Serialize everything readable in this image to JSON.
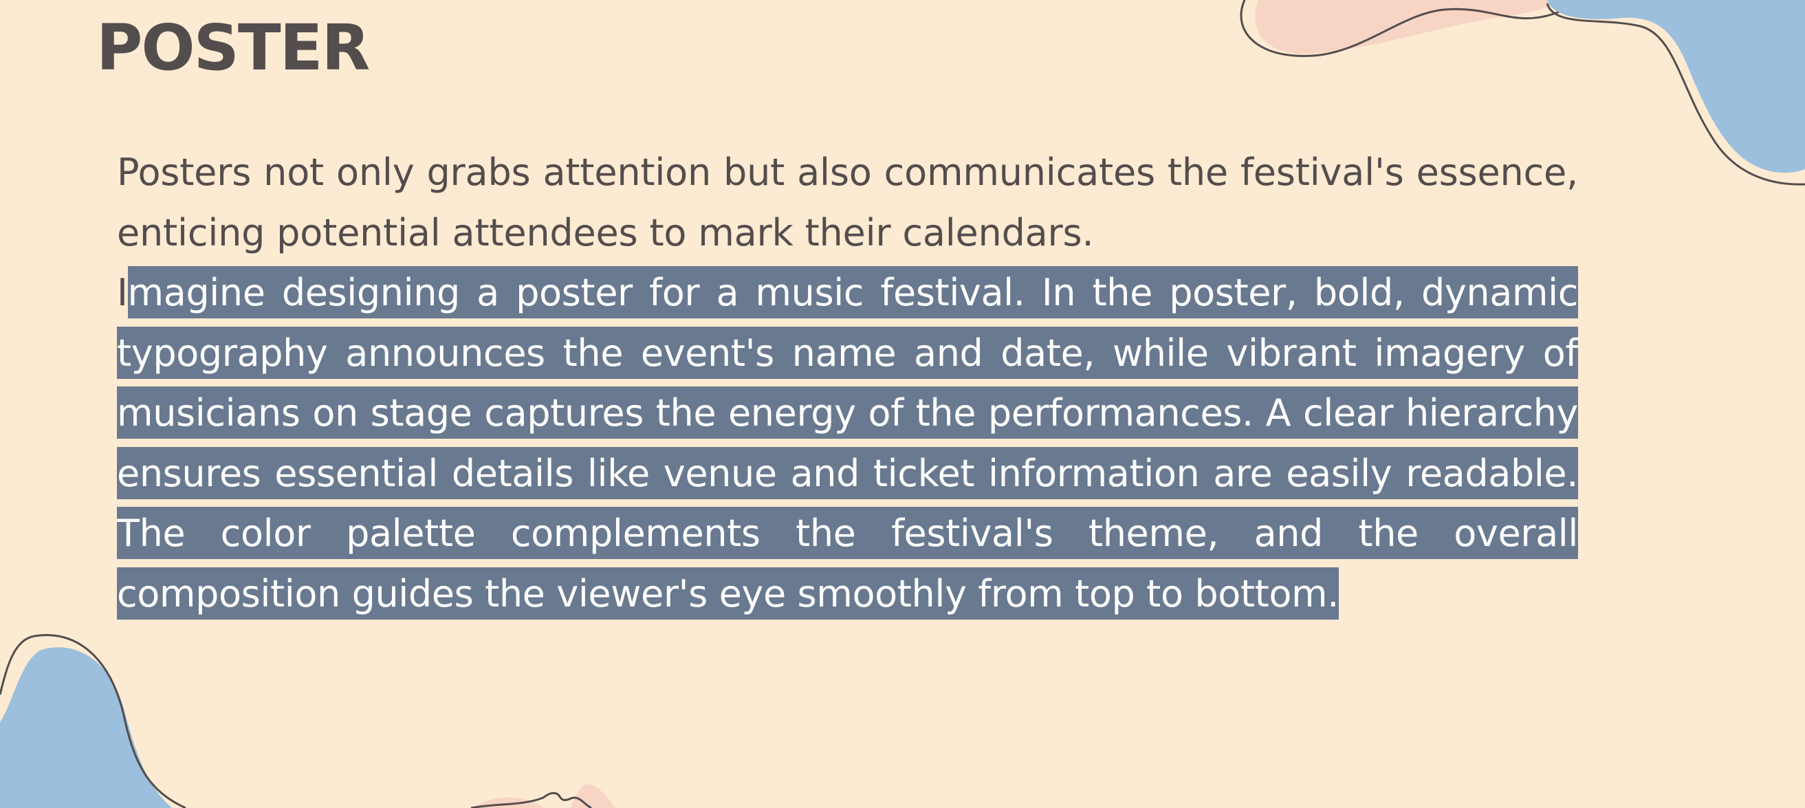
{
  "slide": {
    "title": "POSTER",
    "paragraph_1": "Posters not only grabs attention but also communicates the festival's essence, enticing potential attendees to mark their calendars.",
    "paragraph_2_first_char": "I",
    "paragraph_2_selected": "magine designing a poster for a music festival. In the poster, bold, dynamic typography announces the event's name and date, while vibrant imagery of musicians on stage captures the energy of the performances. A clear hierarchy ensures essential details like venue and ticket information are easily readable. The color palette complements the festival's theme, and the overall composition guides the viewer's eye smoothly from top to bottom."
  },
  "colors": {
    "background": "#fcebd2",
    "text": "#544d4d",
    "selection": "#69798f",
    "selection_text": "#ffffff",
    "blob_blue": "#9bbfdd",
    "blob_pink": "#f7d4c4",
    "outline": "#544d4d"
  }
}
